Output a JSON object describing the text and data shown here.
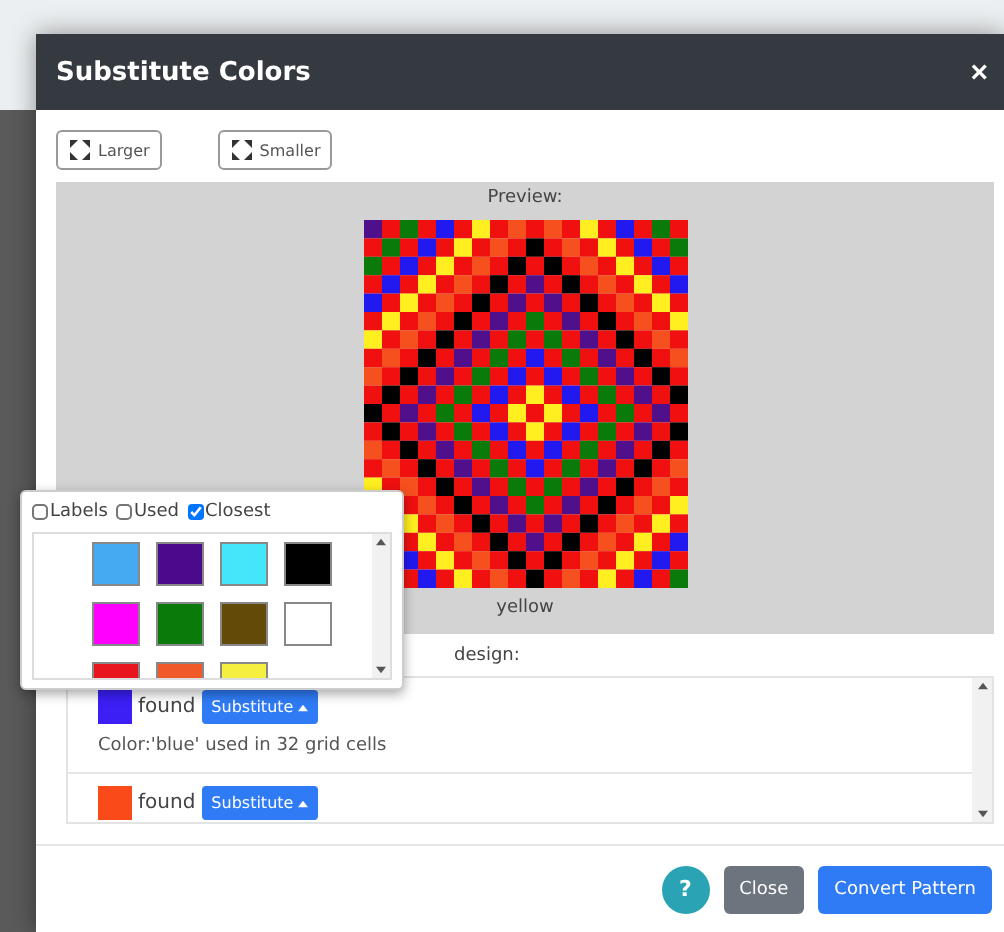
{
  "window": {
    "title": "Substitute Colors",
    "close": "×"
  },
  "zoom_buttons": [
    "Larger",
    "Smaller"
  ],
  "preview": {
    "label": "Preview:",
    "caption": "yellow"
  },
  "design_label": "design:",
  "colors": [
    {
      "color": "#3b1ff5",
      "status": "found",
      "button": "Substitute",
      "caption": "Color:'blue' used in 32 grid cells"
    },
    {
      "color": "#fb4a1a",
      "status": "found",
      "button": "Substitute"
    }
  ],
  "picker": {
    "options": [
      {
        "label": "Labels",
        "checked": false
      },
      {
        "label": "Used",
        "checked": false
      },
      {
        "label": "Closest",
        "checked": true
      }
    ],
    "swatches": [
      {
        "color": "#45aaf2"
      },
      {
        "color": "#4b0a8c"
      },
      {
        "color": "#45e6fa"
      },
      {
        "color": "#000000"
      },
      {
        "color": "#ff00ff"
      },
      {
        "color": "#0a7a0a"
      },
      {
        "color": "#634a08"
      },
      {
        "color": "#ffffff"
      },
      {
        "color": "#e8141e"
      },
      {
        "color": "#f05a28"
      },
      {
        "color": "#f5f040"
      }
    ]
  },
  "footer": {
    "help": "?",
    "buttons": [
      {
        "label": "Close",
        "kind": "secondary"
      },
      {
        "label": "Convert Pattern",
        "kind": "primary"
      }
    ]
  }
}
